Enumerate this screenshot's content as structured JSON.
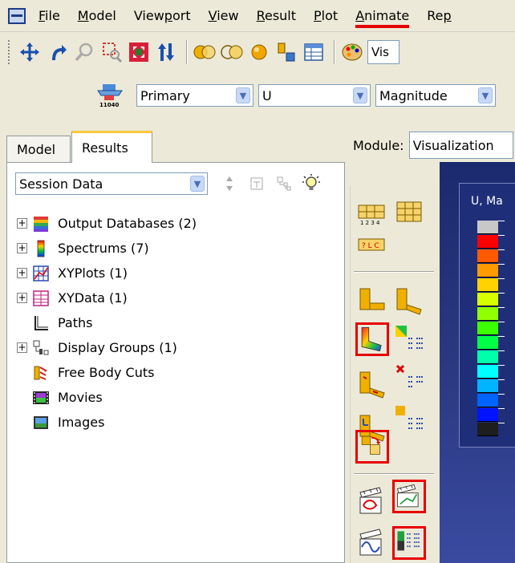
{
  "menubar": {
    "items": [
      {
        "label": "File",
        "underline_index": 0
      },
      {
        "label": "Model",
        "underline_index": 0
      },
      {
        "label": "Viewport",
        "underline_index": 4
      },
      {
        "label": "View",
        "underline_index": 0
      },
      {
        "label": "Result",
        "underline_index": 0
      },
      {
        "label": "Plot",
        "underline_index": 0
      },
      {
        "label": "Animate",
        "underline_index": 0,
        "active": true
      },
      {
        "label": "Rep",
        "underline_index": 2
      }
    ]
  },
  "toolbar1": {
    "visualization_field_text": "Vis"
  },
  "toolbar2": {
    "step_selector": "Primary",
    "variable": "U",
    "invariant": "Magnitude",
    "field_icon_caption": "11040"
  },
  "tabs": [
    {
      "label": "Model"
    },
    {
      "label": "Results",
      "active": true
    }
  ],
  "session": {
    "value": "Session Data"
  },
  "tree": {
    "items": [
      {
        "label": "Output Databases (2)",
        "expandable": true,
        "icon": "database-icon"
      },
      {
        "label": "Spectrums (7)",
        "expandable": true,
        "icon": "spectrum-icon"
      },
      {
        "label": "XYPlots (1)",
        "expandable": true,
        "icon": "xyplot-icon"
      },
      {
        "label": "XYData (1)",
        "expandable": true,
        "icon": "xydata-icon"
      },
      {
        "label": "Paths",
        "expandable": false,
        "icon": "path-icon"
      },
      {
        "label": "Display Groups (1)",
        "expandable": true,
        "icon": "display-group-icon"
      },
      {
        "label": "Free Body Cuts",
        "expandable": false,
        "icon": "free-body-cut-icon"
      },
      {
        "label": "Movies",
        "expandable": false,
        "icon": "movie-icon"
      },
      {
        "label": "Images",
        "expandable": false,
        "icon": "image-icon"
      }
    ]
  },
  "module": {
    "label": "Module:",
    "value": "Visualization"
  },
  "viewport": {
    "legend_title": "U, Ma",
    "legend_colors": [
      "#c8c8c8",
      "#ff0000",
      "#ff5a00",
      "#ff9a00",
      "#ffd200",
      "#d8ff00",
      "#90ff00",
      "#3cff00",
      "#00ff46",
      "#00ffaa",
      "#00ffff",
      "#00b4ff",
      "#0064ff",
      "#0014ff",
      "#1e1e1e"
    ]
  },
  "colors": {
    "menu_active_underline": "#e60000",
    "highlight_border": "#e60000",
    "tab_active_top": "#ffc83c"
  }
}
